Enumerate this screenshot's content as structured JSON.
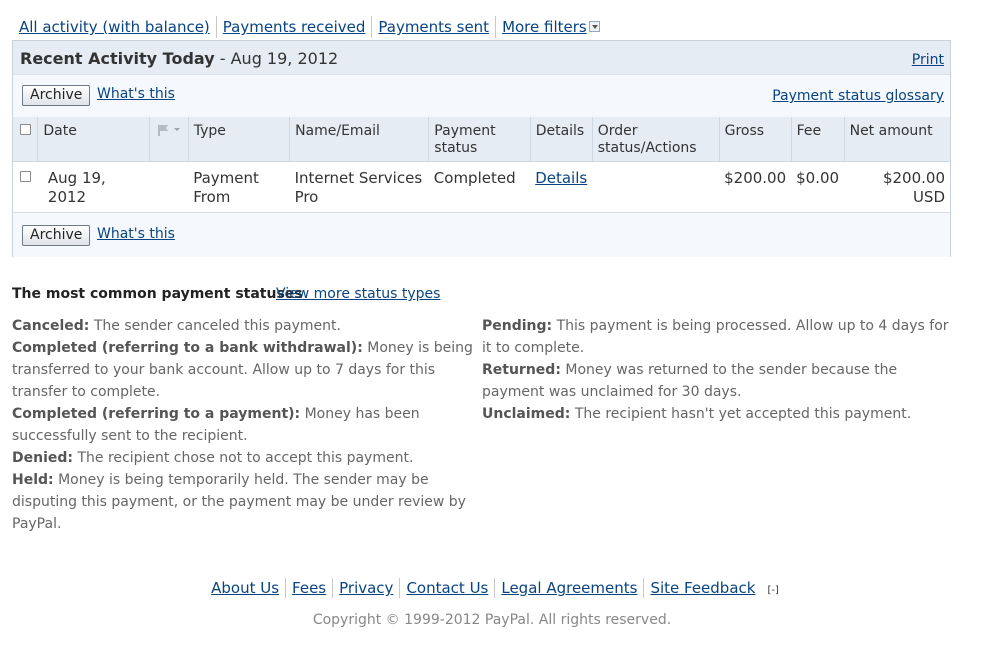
{
  "filters": {
    "all_activity": "All activity (with balance)",
    "received": "Payments received",
    "sent": "Payments sent",
    "more": "More filters"
  },
  "activity": {
    "title_bold": "Recent Activity Today",
    "title_rest": " - Aug 19, 2012",
    "print": "Print",
    "archive": "Archive",
    "whats_this": "What's this",
    "glossary": "Payment status glossary",
    "columns": {
      "date": "Date",
      "type": "Type",
      "name": "Name/Email",
      "status": "Payment status",
      "details": "Details",
      "order": "Order status/Actions",
      "gross": "Gross",
      "fee": "Fee",
      "net": "Net amount"
    },
    "rows": [
      {
        "date": "Aug 19, 2012",
        "type": "Payment From",
        "name": "Internet Services Pro",
        "status": "Completed",
        "details": "Details",
        "order": "",
        "gross": "$200.00",
        "fee": "$0.00",
        "net": "$200.00 USD"
      }
    ]
  },
  "statuses": {
    "title": "The most common payment statuses",
    "more": "View more status types",
    "left": [
      {
        "term": "Canceled:",
        "desc": " The sender canceled this payment."
      },
      {
        "term": "Completed (referring to a bank withdrawal):",
        "desc": " Money is being transferred to your bank account. Allow up to 7 days for this transfer to complete."
      },
      {
        "term": "Completed (referring to a payment):",
        "desc": " Money has been successfully sent to the recipient."
      },
      {
        "term": "Denied:",
        "desc": " The recipient chose not to accept this payment."
      },
      {
        "term": "Held:",
        "desc": " Money is being temporarily held. The sender may be disputing this payment, or the payment may be under review by PayPal."
      }
    ],
    "right": [
      {
        "term": "Pending:",
        "desc": " This payment is being processed. Allow up to 4 days for it to complete."
      },
      {
        "term": "Returned:",
        "desc": " Money was returned to the sender because the payment was unclaimed for 30 days."
      },
      {
        "term": "Unclaimed:",
        "desc": " The recipient hasn't yet accepted this payment."
      }
    ]
  },
  "footer": {
    "links": [
      "About Us",
      "Fees",
      "Privacy",
      "Contact Us",
      "Legal Agreements",
      "Site Feedback"
    ],
    "toggle": "[-]",
    "copyright": "Copyright © 1999-2012 PayPal. All rights reserved."
  },
  "icons": {
    "flag": "flag-icon",
    "dropdown": "dropdown-arrow-icon"
  }
}
